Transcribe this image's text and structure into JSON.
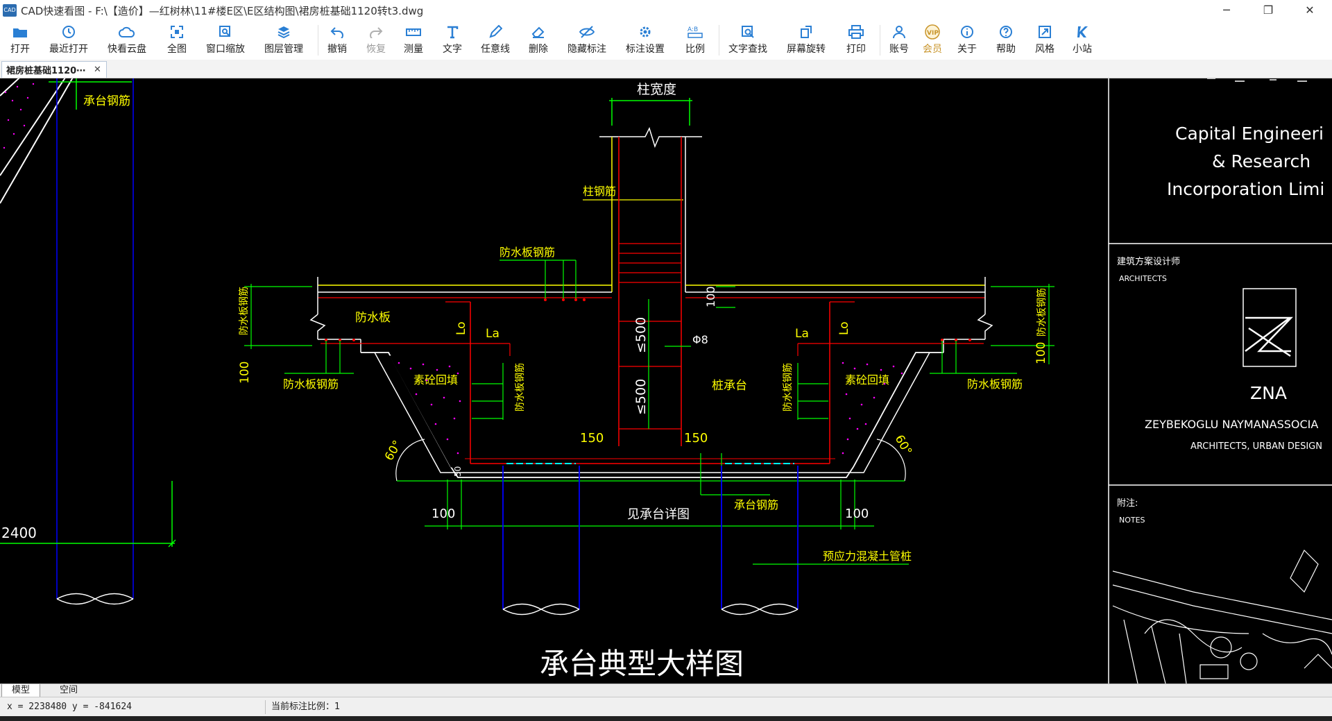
{
  "window": {
    "app_icon_text": "CAD",
    "title": "CAD快速看图 - F:\\【造价】—红树林\\11#楼E区\\E区结构图\\裙房桩基础1120转t3.dwg",
    "minimize": "─",
    "maximize": "❐",
    "close": "✕"
  },
  "toolbar": {
    "open": "打开",
    "recent": "最近打开",
    "cloud": "快看云盘",
    "fit_all": "全图",
    "window_zoom": "窗口缩放",
    "layers": "图层管理",
    "undo": "撤销",
    "redo": "恢复",
    "measure": "测量",
    "text": "文字",
    "freehand": "任意线",
    "erase": "删除",
    "hide_dims": "隐藏标注",
    "dim_settings": "标注设置",
    "scale": "比例",
    "find_text": "文字查找",
    "rotate_screen": "屏幕旋转",
    "print": "打印",
    "account": "账号",
    "member": "会员",
    "about": "关于",
    "help": "帮助",
    "style": "风格",
    "site": "小站"
  },
  "tabs": {
    "document": "裙房桩基础1120⋯",
    "close": "✕"
  },
  "layout_tabs": {
    "model": "模型",
    "paper": "空间"
  },
  "status": {
    "coords": "x = 2238480   y = -841624",
    "scale_label": "当前标注比例：1"
  },
  "drawing": {
    "title": "承台典型大样图",
    "column_width": "柱宽度",
    "column_rebar": "柱钢筋",
    "waterproof_rebar_top": "防水板钢筋",
    "waterproof_board": "防水板",
    "waterproof_rebar_left": "防水板钢筋",
    "waterproof_rebar_right": "防水板钢筋",
    "waterproof_rebar_vert_left": "防水板钢筋",
    "waterproof_rebar_vert_right": "防水板钢筋",
    "waterproof_rebar_in_left": "防水板钢筋",
    "waterproof_rebar_in_right": "防水板钢筋",
    "backfill_left": "素砼回填",
    "backfill_right": "素砼回填",
    "pile_cap": "桩承台",
    "cap_rebar": "承台钢筋",
    "cap_rebar_topleft": "承台钢筋",
    "cap_detail": "见承台详图",
    "prestressed_pile": "预应力混凝土管桩",
    "la": "La",
    "lo": "Lo",
    "spacing_500a": "≤500",
    "spacing_500b": "≤500",
    "phi8": "Φ8",
    "dim_100_top": "100",
    "dim_100_left": "100",
    "dim_100_right": "100",
    "dim_150_left": "150",
    "dim_150_right": "150",
    "dim_100_bl": "100",
    "dim_100_br": "100",
    "dim_50": "50",
    "angle_left": "60°",
    "angle_right": "60°",
    "dim_2400": "2400"
  },
  "title_block": {
    "company_line1": "Capital Engineeri",
    "company_line2": "& Research",
    "company_line3": "Incorporation Limi",
    "architect_cn": "建筑方案设计师",
    "architect_en": "ARCHITECTS",
    "logo_name": "ZNA",
    "firm": "ZEYBEKOGLU NAYMANASSOCIA",
    "firm_sub": "ARCHITECTS, URBAN DESIGN",
    "notes_cn": "附注:",
    "notes_en": "NOTES"
  },
  "colors": {
    "cad_background": "#000000",
    "yellow": "#ffff00",
    "red": "#ff0000",
    "green": "#00ff00",
    "white": "#ffffff",
    "blue": "#0000ff",
    "magenta": "#ff00ff",
    "toolbar_icon_blue": "#2a7fd4",
    "vip_gold": "#c8942a"
  },
  "icons": {
    "open": "folder-icon",
    "recent": "clock-icon",
    "cloud": "cloud-icon",
    "fit_all": "expand-icon",
    "window_zoom": "zoom-window-icon",
    "layers": "layers-icon",
    "undo": "undo-icon",
    "redo": "redo-icon",
    "measure": "ruler-icon",
    "text": "text-icon",
    "freehand": "pen-icon",
    "erase": "eraser-icon",
    "hide_dims": "eye-off-icon",
    "dim_settings": "gear-icon",
    "scale": "scale-icon",
    "find_text": "search-text-icon",
    "rotate_screen": "rotate-icon",
    "print": "printer-icon",
    "account": "user-icon",
    "member": "vip-icon",
    "about": "info-icon",
    "help": "help-icon",
    "style": "style-icon",
    "site": "site-icon"
  }
}
